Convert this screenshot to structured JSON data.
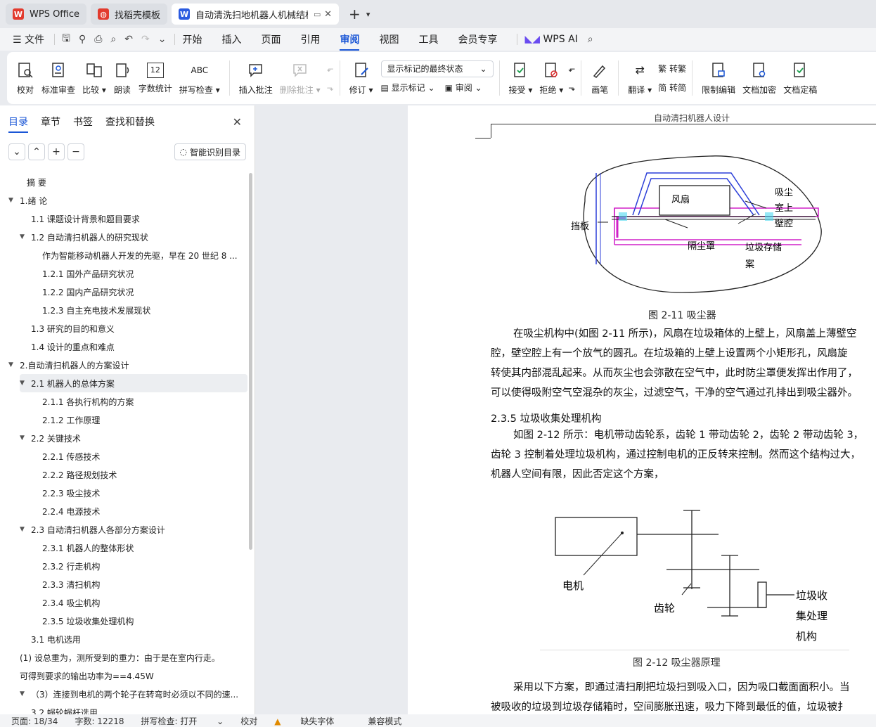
{
  "tabs": [
    {
      "label": "WPS Office",
      "color": "#e23b2e"
    },
    {
      "label": "找稻壳模板",
      "color": "#e23b2e"
    },
    {
      "label": "自动清洗扫地机器人机械结构",
      "color": "#2b5be0"
    }
  ],
  "menu": {
    "file": "文件",
    "tabs": [
      "开始",
      "插入",
      "页面",
      "引用",
      "审阅",
      "视图",
      "工具",
      "会员专享"
    ],
    "active_tab": "审阅",
    "ai": "WPS AI"
  },
  "ribbon": {
    "proofread": "校对",
    "standard_review": "标准审查",
    "compare": "比较",
    "read_aloud": "朗读",
    "word_count": "字数统计",
    "spell_check": "拼写检查",
    "spell_icon_text": "ABC",
    "count_icon_text": "12",
    "insert_comment": "插入批注",
    "delete_comment": "删除批注",
    "track_changes": "修订",
    "markup_state": "显示标记的最终状态",
    "show_markup": "显示标记",
    "review": "审阅",
    "accept": "接受",
    "reject": "拒绝",
    "pen": "画笔",
    "translate": "翻译",
    "to_traditional": "转繁",
    "to_simplified": "转简",
    "restrict_edit": "限制编辑",
    "encrypt": "文档加密",
    "finalize": "文档定稿"
  },
  "nav": {
    "tabs": [
      "目录",
      "章节",
      "书签",
      "查找和替换"
    ],
    "smart_toc": "智能识别目录",
    "toc": [
      {
        "text": "摘    要",
        "level": 0,
        "caret": ""
      },
      {
        "text": "1.绪  论",
        "level": 0,
        "caret": "▼"
      },
      {
        "text": "1.1   课题设计背景和题目要求",
        "level": 1,
        "caret": ""
      },
      {
        "text": "1.2   自动清扫机器人的研究现状",
        "level": 1,
        "caret": "▼"
      },
      {
        "text": "作为智能移动机器人开发的先驱，早在 20 世纪 8 ...",
        "level": 2,
        "caret": ""
      },
      {
        "text": "1.2.1   国外产品研究状况",
        "level": 2,
        "caret": ""
      },
      {
        "text": "1.2.2   国内产品研究状况",
        "level": 2,
        "caret": ""
      },
      {
        "text": "1.2.3   自主充电技术发展现状",
        "level": 2,
        "caret": ""
      },
      {
        "text": "1.3   研究的目的和意义",
        "level": 1,
        "caret": ""
      },
      {
        "text": "1.4   设计的重点和难点",
        "level": 1,
        "caret": ""
      },
      {
        "text": "2.自动清扫机器人的方案设计",
        "level": 0,
        "caret": "▼"
      },
      {
        "text": "2.1   机器人的总体方案",
        "level": 1,
        "caret": "▼",
        "selected": true
      },
      {
        "text": "2.1.1   各执行机构的方案",
        "level": 2,
        "caret": ""
      },
      {
        "text": "2.1.2   工作原理",
        "level": 2,
        "caret": ""
      },
      {
        "text": "2.2   关键技术",
        "level": 1,
        "caret": "▼"
      },
      {
        "text": "2.2.1   传感技术",
        "level": 2,
        "caret": ""
      },
      {
        "text": "2.2.2   路径规划技术",
        "level": 2,
        "caret": ""
      },
      {
        "text": "2.2.3   吸尘技术",
        "level": 2,
        "caret": ""
      },
      {
        "text": "2.2.4   电源技术",
        "level": 2,
        "caret": ""
      },
      {
        "text": "2.3   自动清扫机器人各部分方案设计",
        "level": 1,
        "caret": "▼"
      },
      {
        "text": "2.3.1   机器人的整体形状",
        "level": 2,
        "caret": ""
      },
      {
        "text": "2.3.2   行走机构",
        "level": 2,
        "caret": ""
      },
      {
        "text": "2.3.3   清扫机构",
        "level": 2,
        "caret": ""
      },
      {
        "text": "2.3.4   吸尘机构",
        "level": 2,
        "caret": ""
      },
      {
        "text": "2.3.5   垃圾收集处理机构",
        "level": 2,
        "caret": ""
      },
      {
        "text": "3.1   电机选用",
        "level": 1,
        "caret": ""
      },
      {
        "text": "(1) 设总重为，测所受到的重力：由于是在室内行走。",
        "level": 0,
        "caret": ""
      },
      {
        "text": "可得到要求的输出功率为==4.45W",
        "level": 0,
        "caret": ""
      },
      {
        "text": "（3）连接到电机的两个轮子在转弯时必须以不同的速...",
        "level": 1,
        "caret": "▼"
      },
      {
        "text": "3.2   蜗轮蜗杆选用",
        "level": 1,
        "caret": ""
      }
    ]
  },
  "doc": {
    "running_head": "自动清扫机器人设计",
    "fig1": {
      "labels": {
        "fan": "风扇",
        "baffle": "挡板",
        "chamber1": "吸尘",
        "chamber2": "室上",
        "chamber3": "壁腔",
        "filter": "隔尘罩",
        "bin1": "垃圾存储",
        "bin2": "案"
      },
      "caption": "图 2-11   吸尘器"
    },
    "para1": [
      "在吸尘机构中(如图 2-11 所示)，风扇在垃圾箱体的上壁上，风扇盖上薄壁空",
      "腔，壁空腔上有一个放气的圆孔。在垃圾箱的上壁上设置两个小矩形孔，风扇旋",
      "转使其内部混乱起来。从而灰尘也会弥散在空气中，此时防尘罩便发挥出作用了，",
      "可以使得吸附空气空混杂的灰尘，过滤空气，干净的空气通过孔排出到吸尘器外。"
    ],
    "heading": "2.3.5    垃圾收集处理机构",
    "para2": [
      "如图 2-12 所示：电机带动齿轮系，齿轮 1 带动齿轮 2，齿轮 2 带动齿轮 3，",
      "齿轮 3 控制着处理垃圾机构，通过控制电机的正反转来控制。然而这个结构过大，",
      "机器人空间有限，因此否定这个方案，"
    ],
    "fig2": {
      "labels": {
        "motor": "电机",
        "gear": "齿轮",
        "mech1": "垃圾收",
        "mech2": "集处理",
        "mech3": "机构"
      },
      "caption": "图 2-12   吸尘器原理"
    },
    "para3": [
      "采用以下方案，即通过清扫刷把垃圾扫到吸入口，因为吸口截面面积小。当",
      "被吸收的垃圾到垃圾存储箱时，空间膨胀迅速，吸力下降到最低的值，垃圾被扌"
    ]
  },
  "status": {
    "page": "页面: 18/34",
    "words": "字数: 12218",
    "spell": "拼写检查: 打开",
    "proof": "校对",
    "missing_font": "缺失字体",
    "compat": "兼容模式"
  },
  "colors": {
    "accent": "#1a56d6",
    "magenta": "#d020c8",
    "blue_line": "#2c3fd8"
  }
}
